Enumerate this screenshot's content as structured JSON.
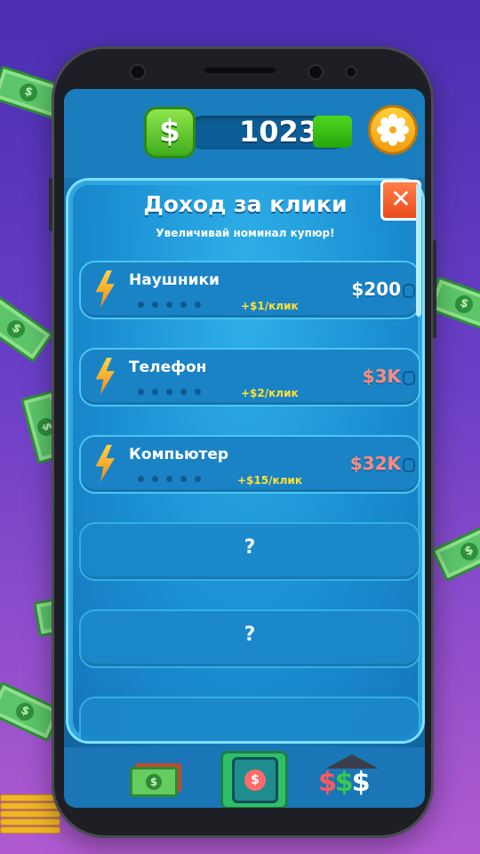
{
  "header": {
    "currency_symbol": "$",
    "balance": "1023"
  },
  "panel": {
    "title": "Доход за клики",
    "subtitle": "Увеличивай номинал купюр!",
    "close_label": "✕"
  },
  "upgrades": [
    {
      "name": "Наушники",
      "income": "+$1/клик",
      "price": "$200",
      "price_color": "#ffffff",
      "locked": false
    },
    {
      "name": "Телефон",
      "income": "+$2/клик",
      "price": "$3K",
      "price_color": "#ff8a80",
      "locked": false
    },
    {
      "name": "Компьютер",
      "income": "+$15/клик",
      "price": "$32K",
      "price_color": "#ff8a80",
      "locked": false
    },
    {
      "name": "?",
      "locked": true
    },
    {
      "name": "?",
      "locked": true
    }
  ],
  "bottom_nav": {
    "items": [
      "cash-icon",
      "safe-icon",
      "bank-icon"
    ],
    "bank_symbol": "$"
  },
  "colors": {
    "accent": "#1b8fd3",
    "income": "#ffe033",
    "locked_price": "#ff8a80"
  }
}
